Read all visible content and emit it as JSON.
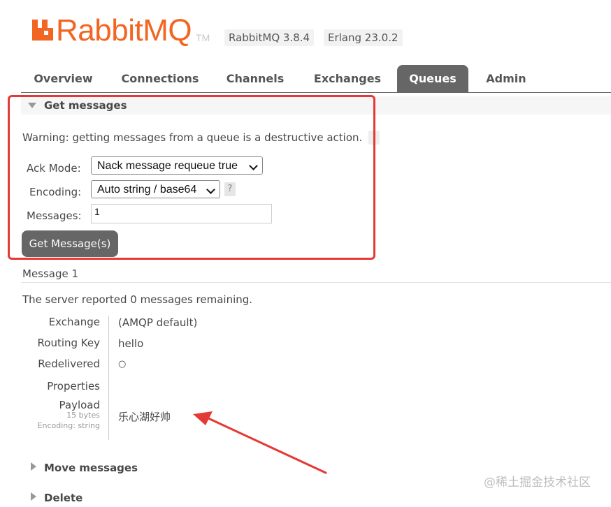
{
  "header": {
    "logo_text": "RabbitMQ",
    "logo_tm": "TM",
    "rabbitmq_version": "RabbitMQ 3.8.4",
    "erlang_version": "Erlang 23.0.2",
    "brand_color": "#f26522"
  },
  "tabs": [
    {
      "label": "Overview",
      "active": false
    },
    {
      "label": "Connections",
      "active": false
    },
    {
      "label": "Channels",
      "active": false
    },
    {
      "label": "Exchanges",
      "active": false
    },
    {
      "label": "Queues",
      "active": true
    },
    {
      "label": "Admin",
      "active": false
    }
  ],
  "get_messages": {
    "title": "Get messages",
    "warning": "Warning: getting messages from a queue is a destructive action.",
    "help_symbol": "?",
    "ack_mode_label": "Ack Mode:",
    "ack_mode_value": "Nack message requeue true",
    "encoding_label": "Encoding:",
    "encoding_value": "Auto string / base64",
    "messages_label": "Messages:",
    "messages_value": "1",
    "button_label": "Get Message(s)"
  },
  "result": {
    "message_heading": "Message 1",
    "remaining_prefix": "The server reported ",
    "remaining_count": "0",
    "remaining_suffix": " messages remaining.",
    "fields": {
      "exchange_label": "Exchange",
      "exchange_value": "(AMQP default)",
      "routing_key_label": "Routing Key",
      "routing_key_value": "hello",
      "redelivered_label": "Redelivered",
      "redelivered_value": "○",
      "properties_label": "Properties",
      "payload_label": "Payload",
      "payload_size": "15 bytes",
      "payload_encoding": "Encoding: string",
      "payload_value": "乐心湖好帅"
    }
  },
  "sections": {
    "move_messages": "Move messages",
    "delete": "Delete"
  },
  "watermark": "@稀土掘金技术社区",
  "annotation_color": "#e53935"
}
